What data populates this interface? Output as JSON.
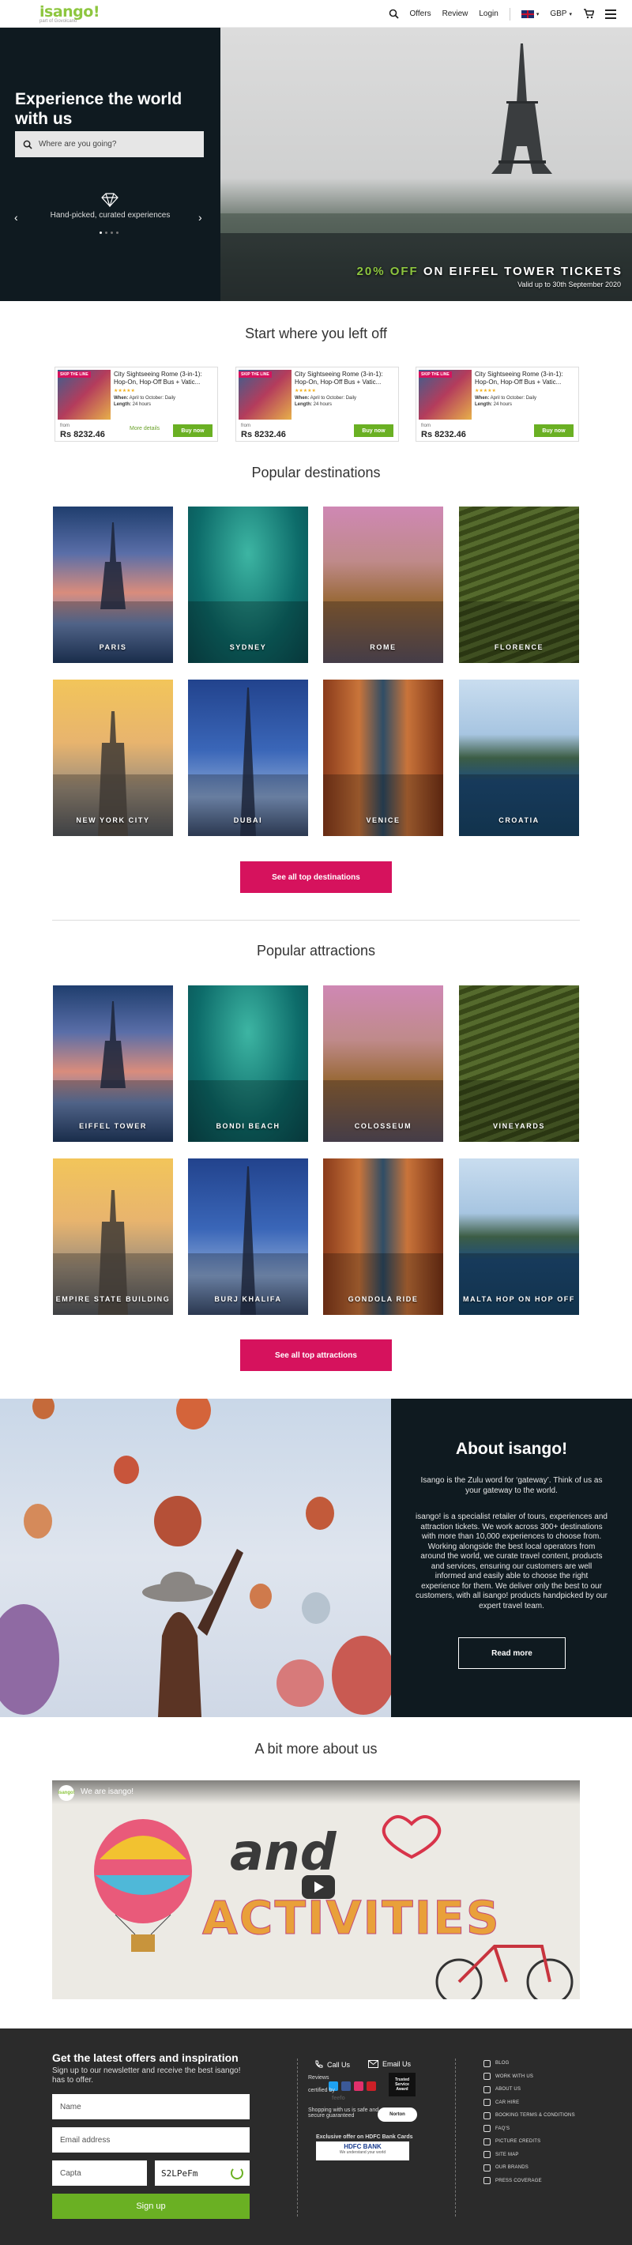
{
  "header": {
    "logo": "isango!",
    "logo_sub": "part of Govolcano",
    "nav": {
      "offers": "Offers",
      "review": "Review",
      "login": "Login",
      "currency": "GBP"
    }
  },
  "hero": {
    "title": "Experience the world with us",
    "search_placeholder": "Where are you going?",
    "caption": "Hand-picked, curated experiences",
    "promo_pct": "20% OFF",
    "promo_rest": "ON EIFFEL TOWER TICKETS",
    "valid": "Valid up to 30th September 2020"
  },
  "recent": {
    "title": "Start where you left off",
    "cards": [
      {
        "ribbon": "SKIP THE LINE",
        "name": "City Sightseeing Rome (3-in-1): Hop-On, Hop-Off Bus + Vatic...",
        "stars": "★★★★★",
        "when_label": "When:",
        "when": "April to October: Daily",
        "length_label": "Length:",
        "length": "24 hours",
        "from": "from",
        "price": "Rs 8232.46",
        "more": "More details",
        "buy": "Buy now"
      },
      {
        "ribbon": "SKIP THE LINE",
        "name": "City Sightseeing Rome (3-in-1): Hop-On, Hop-Off Bus + Vatic...",
        "stars": "★★★★★",
        "when_label": "When:",
        "when": "April to October: Daily",
        "length_label": "Length:",
        "length": "24 hours",
        "from": "from",
        "price": "Rs 8232.46",
        "more": "",
        "buy": "Buy now"
      },
      {
        "ribbon": "SKIP THE LINE",
        "name": "City Sightseeing Rome (3-in-1): Hop-On, Hop-Off Bus + Vatic...",
        "stars": "★★★★★",
        "when_label": "When:",
        "when": "April to October: Daily",
        "length_label": "Length:",
        "length": "24 hours",
        "from": "from",
        "price": "Rs 8232.46",
        "more": "",
        "buy": "Buy now"
      }
    ]
  },
  "destinations": {
    "title": "Popular destinations",
    "items": [
      "PARIS",
      "SYDNEY",
      "ROME",
      "FLORENCE",
      "NEW YORK CITY",
      "DUBAI",
      "VENICE",
      "CROATIA"
    ],
    "button": "See all top destinations"
  },
  "attractions": {
    "title": "Popular attractions",
    "items": [
      "EIFFEL TOWER",
      "BONDI BEACH",
      "COLOSSEUM",
      "VINEYARDS",
      "EMPIRE STATE BUILDING",
      "BURJ KHALIFA",
      "GONDOLA RIDE",
      "MALTA HOP ON HOP OFF"
    ],
    "button": "See all top attractions"
  },
  "about": {
    "title": "About isango!",
    "p1": "Isango is the Zulu word for ‘gateway’. Think of us as your gateway to the world.",
    "p2": "isango! is a specialist retailer of tours, experiences and attraction tickets. We work across 300+ destinations with more than 10,000 experiences to choose from. Working alongside the best local operators from around the world, we curate travel content, products and services, ensuring our customers are well informed and easily able to choose the right experience for them. We deliver only the best to our customers, with all isango! products handpicked by our expert travel team.",
    "button": "Read more"
  },
  "more_about": {
    "title": "A bit more about us",
    "video_title": "We are isango!",
    "video_channel": "isango!",
    "video_word1": "and",
    "video_word2": "ACTIVITIES"
  },
  "footer": {
    "title": "Get the latest offers and inspiration",
    "subtitle": "Sign up to our newsletter and receive the best isango! has to offer.",
    "name_placeholder": "Name",
    "email_placeholder": "Email address",
    "captcha_placeholder": "Capta",
    "captcha_code": "S2LPeFm",
    "signup": "Sign up",
    "call": "Call Us",
    "email": "Email Us",
    "reviews": "Reviews",
    "certified": "certified by",
    "feefo": "feefo",
    "trusted": "Trusted Service Award",
    "secure": "Shopping with us is safe and secure guaranteed",
    "norton": "Norton",
    "hdfc_offer": "Exclusive offer on HDFC Bank Cards",
    "hdfc": "HDFC BANK",
    "hdfc_tag": "We understand your world",
    "links": [
      "BLOG",
      "WORK WITH US",
      "ABOUT US",
      "CAR HIRE",
      "BOOKING TERMS & CONDITIONS",
      "FAQ'S",
      "PICTURE CREDITS",
      "SITE MAP",
      "OUR BRANDS",
      "PRESS COVERAGE"
    ]
  },
  "colors": {
    "brand_green": "#8dc63f",
    "button_green": "#6ab023",
    "pink": "#d6125d",
    "dark": "#0f1a20",
    "footer": "#2b2b2b"
  },
  "icons": [
    "search-icon",
    "cart-icon",
    "menu-icon",
    "diamond-icon",
    "chevron-left-icon",
    "chevron-right-icon",
    "phone-icon",
    "mail-icon",
    "refresh-icon"
  ]
}
